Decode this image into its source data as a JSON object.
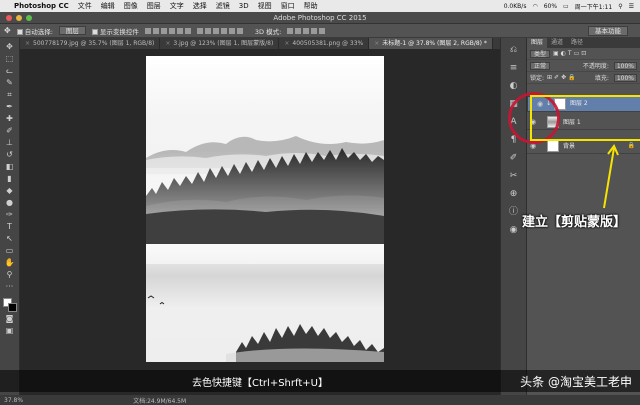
{
  "menubar": {
    "app": "Photoshop CC",
    "items": [
      "文件",
      "编辑",
      "图像",
      "图层",
      "文字",
      "选择",
      "滤镜",
      "3D",
      "视图",
      "窗口",
      "帮助"
    ],
    "net": "0.0KB/s",
    "battery": "60%",
    "time": "周一下午1:11"
  },
  "titlebar": {
    "title": "Adobe Photoshop CC 2015"
  },
  "options": {
    "auto_select": "自动选择:",
    "layer_select": "图层",
    "transform": "显示变换控件",
    "mode3d": "3D 模式:",
    "workspace": "基本功能"
  },
  "tabs": [
    {
      "label": "500778179.jpg @ 35.7% (图层 1, RGB/8)",
      "active": false
    },
    {
      "label": "3.jpg @ 123% (图层 1, 图层蒙版/8)",
      "active": false
    },
    {
      "label": "400505381.png @ 33%",
      "active": false
    },
    {
      "label": "未标题-1 @ 37.8% (图层 2, RGB/8) *",
      "active": true
    }
  ],
  "status": {
    "zoom": "37.8%",
    "doc": "文档:24.9M/64.5M"
  },
  "layers": {
    "tabs": [
      "图层",
      "通道",
      "路径"
    ],
    "kind": "类型",
    "blend": "正常",
    "opacity_label": "不透明度:",
    "opacity": "100%",
    "lock_label": "锁定:",
    "fill_label": "填充:",
    "fill": "100%",
    "items": [
      {
        "name": "图层 2",
        "selected": true
      },
      {
        "name": "图层 1",
        "selected": false
      },
      {
        "name": "背景",
        "selected": false
      }
    ]
  },
  "annotation": {
    "text": "建立【剪贴蒙版】"
  },
  "subtitle": {
    "caption": "去色快捷键【Ctrl+Shrft+U】",
    "watermark": "头条 @淘宝美工老申"
  },
  "colors": {
    "highlight": "#f5e400",
    "selection": "#627fab",
    "circle": "#c81432"
  }
}
